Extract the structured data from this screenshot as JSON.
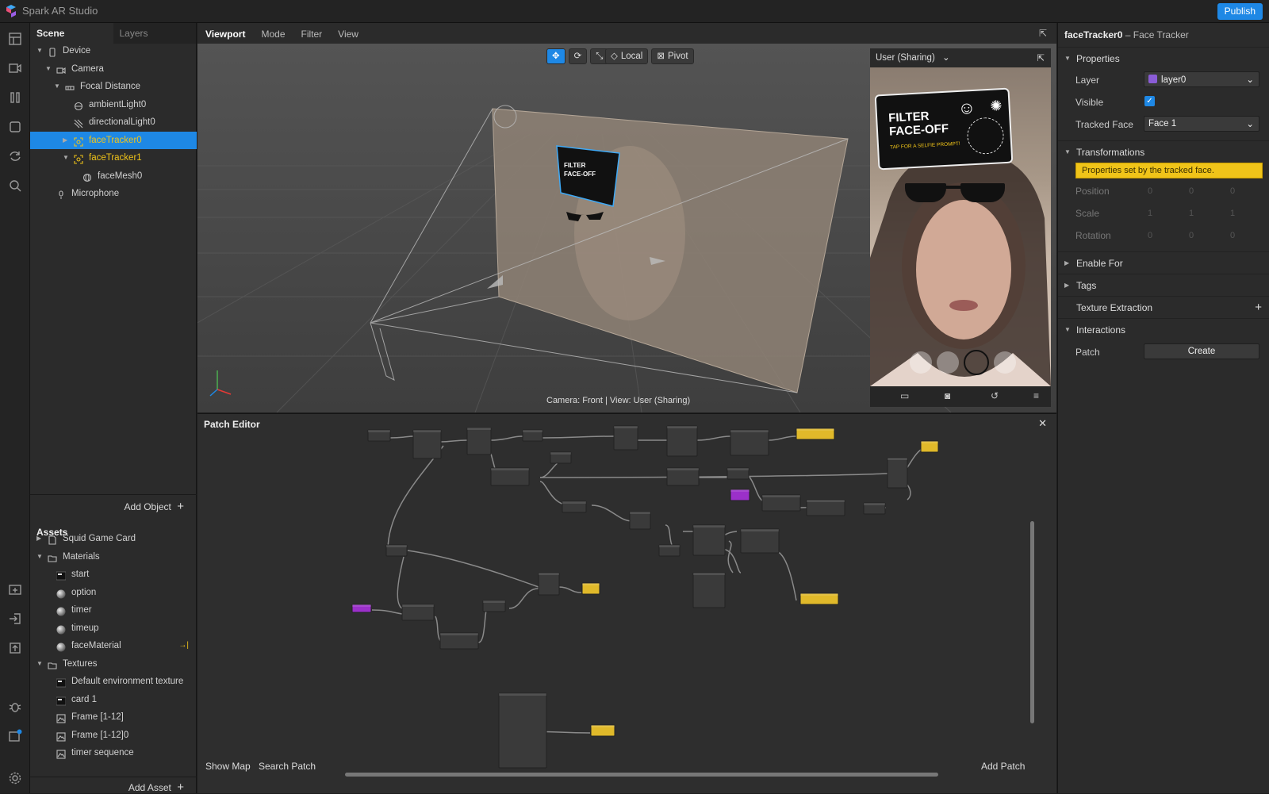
{
  "app": {
    "title": "Spark AR Studio",
    "publish_label": "Publish"
  },
  "scene_panel": {
    "tabs": [
      "Scene",
      "Layers"
    ],
    "tree": [
      {
        "label": "Device",
        "icon": "device-icon",
        "indent": 0,
        "expanded": true
      },
      {
        "label": "Camera",
        "icon": "camera-icon",
        "indent": 1,
        "expanded": true
      },
      {
        "label": "Focal Distance",
        "icon": "focal-icon",
        "indent": 2,
        "expanded": true
      },
      {
        "label": "ambientLight0",
        "icon": "ambient-light-icon",
        "indent": 3
      },
      {
        "label": "directionalLight0",
        "icon": "directional-light-icon",
        "indent": 3
      },
      {
        "label": "faceTracker0",
        "icon": "face-tracker-icon",
        "indent": 3,
        "selected": true,
        "collapsed": true
      },
      {
        "label": "faceTracker1",
        "icon": "face-tracker-icon",
        "indent": 3,
        "expanded": true,
        "yellow": true
      },
      {
        "label": "faceMesh0",
        "icon": "mesh-icon",
        "indent": 4
      },
      {
        "label": "Microphone",
        "icon": "microphone-icon",
        "indent": 1
      }
    ],
    "add_object_label": "Add Object",
    "assets_title": "Assets",
    "assets": [
      {
        "label": "Squid Game Card",
        "icon": "file-icon",
        "indent": 0,
        "collapsed": true
      },
      {
        "label": "Materials",
        "icon": "folder-icon",
        "indent": 0,
        "expanded": true
      },
      {
        "label": "start",
        "icon": "texture-thumb-icon",
        "indent": 1
      },
      {
        "label": "option",
        "icon": "sphere-icon",
        "indent": 1
      },
      {
        "label": "timer",
        "icon": "sphere-icon",
        "indent": 1
      },
      {
        "label": "timeup",
        "icon": "sphere-icon",
        "indent": 1
      },
      {
        "label": "faceMaterial",
        "icon": "sphere-icon",
        "indent": 1,
        "arrow": true
      },
      {
        "label": "Textures",
        "icon": "folder-icon",
        "indent": 0,
        "expanded": true
      },
      {
        "label": "Default environment texture",
        "icon": "texture-thumb-icon",
        "indent": 1
      },
      {
        "label": "card 1",
        "icon": "texture-thumb-icon",
        "indent": 1
      },
      {
        "label": "Frame [1-12]",
        "icon": "image-icon",
        "indent": 1
      },
      {
        "label": "Frame [1-12]0",
        "icon": "image-icon",
        "indent": 1
      },
      {
        "label": "timer sequence",
        "icon": "image-icon",
        "indent": 1
      }
    ],
    "add_asset_label": "Add Asset"
  },
  "viewport": {
    "tabs": [
      "Viewport",
      "Mode",
      "Filter",
      "View"
    ],
    "local_label": "Local",
    "pivot_label": "Pivot",
    "caption": "Camera: Front | View: User (Sharing)",
    "preview_device": "User (Sharing)",
    "card_title": "FILTER FACE-OFF",
    "card_sub": "TAP FOR A SELFIE PROMPT!"
  },
  "patch_editor": {
    "title": "Patch Editor",
    "show_map": "Show Map",
    "search_patch": "Search Patch",
    "add_patch": "Add Patch"
  },
  "properties": {
    "object_name": "faceTracker0",
    "object_type": "– Face Tracker",
    "properties_section": "Properties",
    "layer_label": "Layer",
    "layer_value": "layer0",
    "layer_color": "#8a5cd6",
    "visible_label": "Visible",
    "visible": true,
    "tracked_face_label": "Tracked Face",
    "tracked_face_value": "Face 1",
    "transformations_section": "Transformations",
    "notice": "Properties set by the tracked face.",
    "position_label": "Position",
    "scale_label": "Scale",
    "rotation_label": "Rotation",
    "position_values": [
      "0",
      "0",
      "0"
    ],
    "scale_values": [
      "1",
      "1",
      "1"
    ],
    "rotation_values": [
      "0",
      "0",
      "0"
    ],
    "enable_for": "Enable For",
    "tags": "Tags",
    "texture_extraction": "Texture Extraction",
    "interactions": "Interactions",
    "patch_label": "Patch",
    "create_label": "Create"
  },
  "colors": {
    "accent": "#1e88e5",
    "selection_yellow": "#f0c419",
    "notice_bg": "#f0c419"
  }
}
